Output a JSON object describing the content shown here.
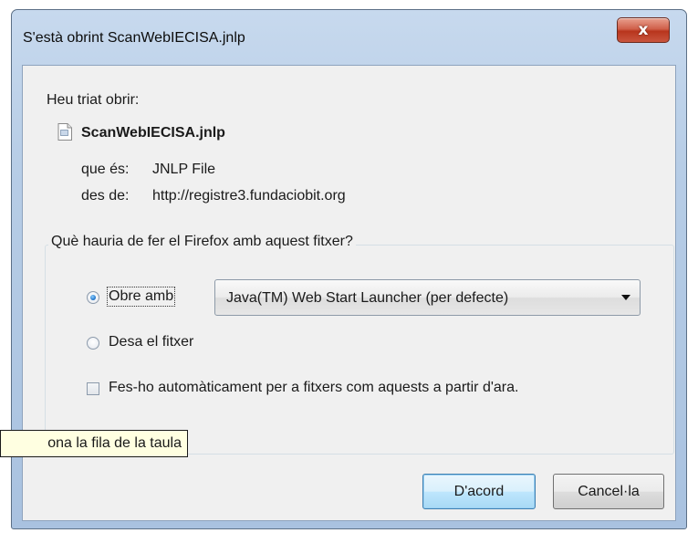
{
  "window": {
    "title": "S'està obrint ScanWebIECISA.jnlp",
    "close_label": "x"
  },
  "intro_label": "Heu triat obrir:",
  "file": {
    "icon": "document-icon",
    "name": "ScanWebIECISA.jnlp",
    "type_label": "que és:",
    "type_value": "JNLP File",
    "from_label": "des de:",
    "from_value": "http://registre3.fundaciobit.org"
  },
  "action_group": {
    "legend": "Què hauria de fer el Firefox amb aquest fitxer?",
    "open_with": {
      "label": "Obre amb",
      "checked": true,
      "selected_app": "Java(TM) Web Start Launcher (per defecte)"
    },
    "save": {
      "label": "Desa el fitxer",
      "checked": false
    },
    "auto": {
      "label": "Fes-ho automàticament per a fitxers com aquests a partir d'ara.",
      "checked": false
    }
  },
  "buttons": {
    "ok": "D'acord",
    "cancel": "Cancel·la"
  },
  "tooltip": "ona la fila de la taula",
  "colors": {
    "title_bar": "#b9cfe8",
    "close_button": "#c7533c",
    "client_bg": "#f0f0f0",
    "tooltip_bg": "#ffffe1",
    "default_button_border": "#3c7fb1"
  }
}
